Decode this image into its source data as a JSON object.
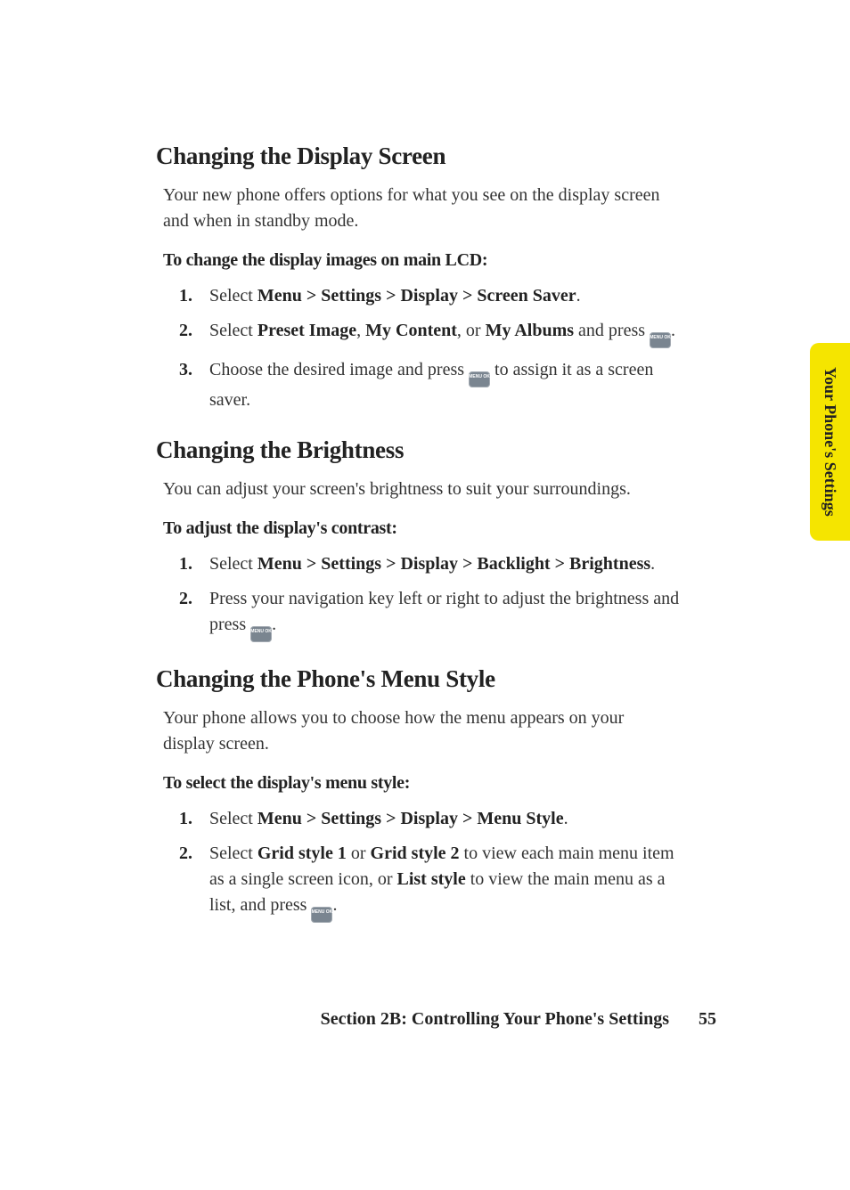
{
  "side_tab": "Your Phone's Settings",
  "sections": [
    {
      "heading": "Changing the Display Screen",
      "intro": "Your new phone offers options for what you see on the display screen and when in standby mode.",
      "subhead": "To change the display images on main LCD:",
      "steps_key": "s1"
    },
    {
      "heading": "Changing the Brightness",
      "intro": "You can adjust your screen's brightness to suit your surroundings.",
      "subhead": "To adjust the display's contrast:",
      "steps_key": "s2"
    },
    {
      "heading": "Changing the Phone's Menu Style",
      "intro": "Your phone allows you to choose how the menu appears on your display screen.",
      "subhead": "To select the display's menu style:",
      "steps_key": "s3"
    }
  ],
  "steps": {
    "s1": {
      "1": {
        "pre": "Select ",
        "bolds": [
          "Menu",
          ">",
          "Settings",
          ">",
          "Display",
          ">",
          "Screen Saver"
        ],
        "post": "."
      },
      "2": {
        "pre": "Select ",
        "b1": "Preset Image",
        "t1": ", ",
        "b2": "My Content",
        "t2": ", or ",
        "b3": "My Albums",
        "t3": " and press ",
        "icon": true,
        "post": "."
      },
      "3": {
        "pre": "Choose the desired image and press ",
        "icon": true,
        "post": " to assign it as a screen saver."
      }
    },
    "s2": {
      "1": {
        "pre": "Select ",
        "bolds": [
          "Menu",
          ">",
          "Settings",
          ">",
          "Display",
          ">",
          "Backlight",
          ">",
          "Brightness"
        ],
        "post": "."
      },
      "2": {
        "pre": "Press your navigation key left or right to adjust the brightness and press ",
        "icon": true,
        "post": "."
      }
    },
    "s3": {
      "1": {
        "pre": "Select ",
        "bolds": [
          "Menu",
          ">",
          "Settings",
          ">",
          "Display",
          ">",
          "Menu Style"
        ],
        "post": "."
      },
      "2": {
        "pre": "Select ",
        "b1": "Grid style 1",
        "t1": " or ",
        "b2": "Grid style 2",
        "t2": " to view each main menu item as a single screen icon, or ",
        "b3": "List style",
        "t3": " to view the main menu as a list, and press ",
        "icon": true,
        "post": "."
      }
    }
  },
  "key_icon_label": "MENU\nOK",
  "footer": {
    "label": "Section 2B: Controlling Your Phone's Settings",
    "page": "55"
  }
}
